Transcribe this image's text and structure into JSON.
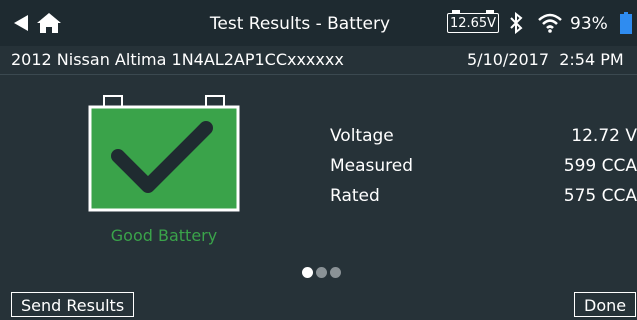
{
  "header": {
    "title": "Test Results - Battery",
    "tester_voltage": "12.65V",
    "battery_percent": "93%",
    "icons": [
      "back-arrow-icon",
      "home-icon",
      "bluetooth-icon",
      "wifi-icon",
      "battery-icon"
    ]
  },
  "vehicle": {
    "description": "2012 Nissan Altima 1N4AL2AP1CCxxxxxx",
    "date": "5/10/2017",
    "time": "2:54 PM"
  },
  "result": {
    "status": "Good Battery",
    "status_color": "#3aa34a",
    "battery_fill_color": "#3aa34a",
    "metrics": [
      {
        "label": "Voltage",
        "value": "12.72 V"
      },
      {
        "label": "Measured",
        "value": "599 CCA"
      },
      {
        "label": "Rated",
        "value": "575 CCA"
      }
    ]
  },
  "pager": {
    "total": 3,
    "active": 1
  },
  "footer": {
    "send_label": "Send Results",
    "done_label": "Done"
  }
}
